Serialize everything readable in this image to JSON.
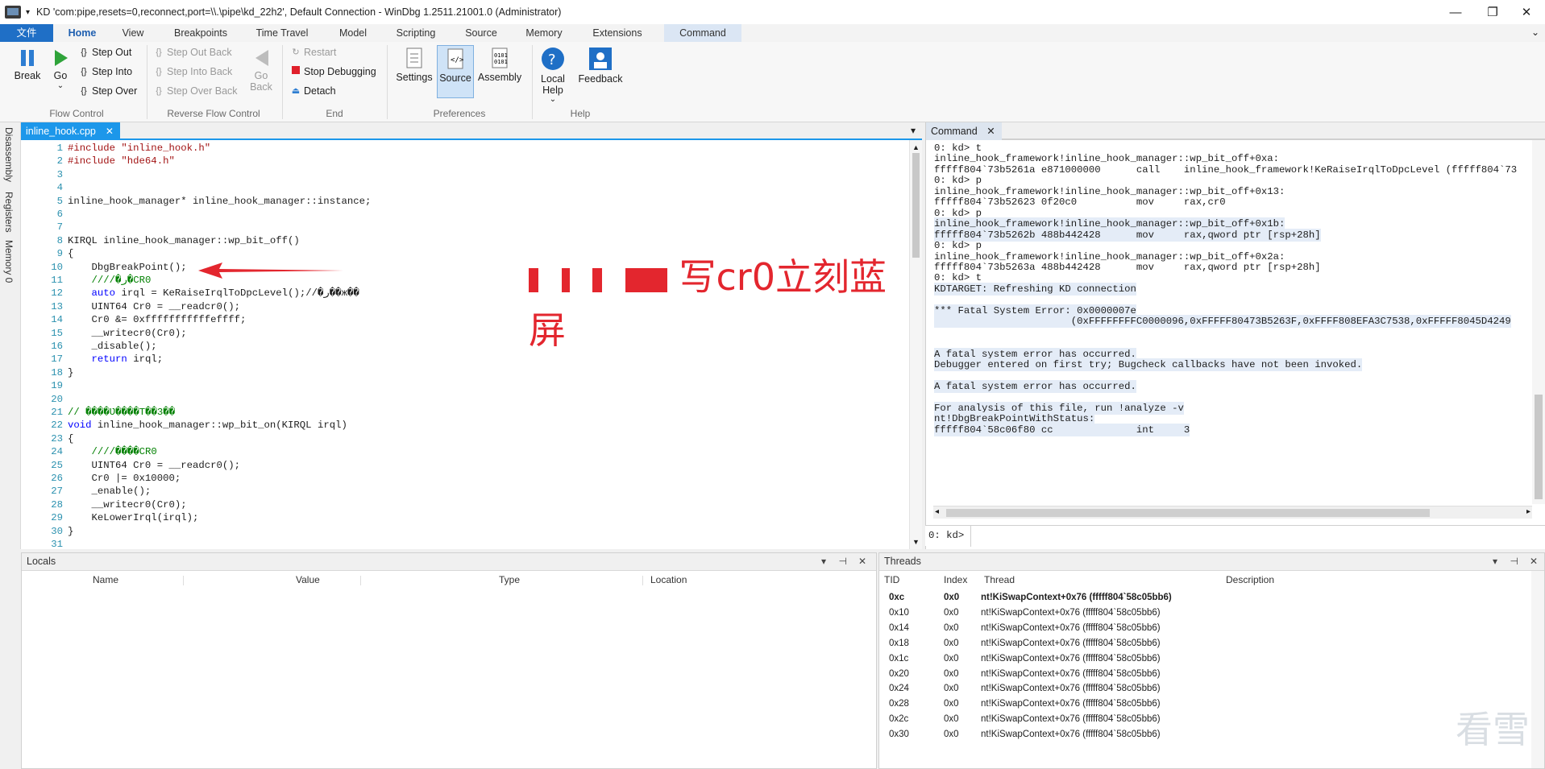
{
  "window": {
    "title": "KD 'com:pipe,resets=0,reconnect,port=\\\\.\\pipe\\kd_22h2', Default Connection  - WinDbg 1.2511.21001.0 (Administrator)",
    "min": "—",
    "max": "❐",
    "close": "✕"
  },
  "tabs": [
    "文件",
    "Home",
    "View",
    "Breakpoints",
    "Time Travel",
    "Model",
    "Scripting",
    "Source",
    "Memory",
    "Extensions",
    "Command"
  ],
  "ribbon": {
    "break": "Break",
    "go": "Go",
    "step_out": "Step Out",
    "step_into": "Step Into",
    "step_over": "Step Over",
    "step_out_back": "Step Out Back",
    "step_into_back": "Step Into Back",
    "step_over_back": "Step Over Back",
    "go_back": "Go Back",
    "restart": "Restart",
    "stop_debugging": "Stop Debugging",
    "detach": "Detach",
    "settings": "Settings",
    "source": "Source",
    "assembly": "Assembly",
    "local_help": "Local Help",
    "feedback": "Feedback",
    "groups": {
      "flow_control": "Flow Control",
      "reverse_flow_control": "Reverse Flow Control",
      "end": "End",
      "preferences": "Preferences",
      "help": "Help"
    }
  },
  "side_tabs": [
    "Disassembly",
    "Registers",
    "Memory 0"
  ],
  "editor": {
    "tab": "inline_hook.cpp",
    "close": "✕",
    "overlay": "写cr0立刻蓝屏",
    "lines": [
      {
        "n": "1",
        "t": "#include \"inline_hook.h\""
      },
      {
        "n": "2",
        "t": "#include \"hde64.h\""
      },
      {
        "n": "3",
        "t": ""
      },
      {
        "n": "4",
        "t": ""
      },
      {
        "n": "5",
        "t": "inline_hook_manager* inline_hook_manager::instance;"
      },
      {
        "n": "6",
        "t": ""
      },
      {
        "n": "7",
        "t": ""
      },
      {
        "n": "8",
        "t": "KIRQL inline_hook_manager::wp_bit_off()"
      },
      {
        "n": "9",
        "t": "{"
      },
      {
        "n": "10",
        "t": "    DbgBreakPoint();"
      },
      {
        "n": "11",
        "t": "    ////�ر�CR0"
      },
      {
        "n": "12",
        "t": "    auto irql = KeRaiseIrqlToDpcLevel();//�ر��ж��"
      },
      {
        "n": "13",
        "t": "    UINT64 Cr0 = __readcr0();"
      },
      {
        "n": "14",
        "t": "    Cr0 &= 0xfffffffffffeffff;"
      },
      {
        "n": "15",
        "t": "    __writecr0(Cr0);"
      },
      {
        "n": "16",
        "t": "    _disable();"
      },
      {
        "n": "17",
        "t": "    return irql;"
      },
      {
        "n": "18",
        "t": "}"
      },
      {
        "n": "19",
        "t": ""
      },
      {
        "n": "20",
        "t": ""
      },
      {
        "n": "21",
        "t": "// ����Ʋ����T��3��"
      },
      {
        "n": "22",
        "t": "void inline_hook_manager::wp_bit_on(KIRQL irql)"
      },
      {
        "n": "23",
        "t": "{"
      },
      {
        "n": "24",
        "t": "    ////����CR0"
      },
      {
        "n": "25",
        "t": "    UINT64 Cr0 = __readcr0();"
      },
      {
        "n": "26",
        "t": "    Cr0 |= 0x10000;"
      },
      {
        "n": "27",
        "t": "    _enable();"
      },
      {
        "n": "28",
        "t": "    __writecr0(Cr0);"
      },
      {
        "n": "29",
        "t": "    KeLowerIrql(irql);"
      },
      {
        "n": "30",
        "t": "}"
      },
      {
        "n": "31",
        "t": ""
      }
    ]
  },
  "command": {
    "tab": "Command",
    "close": "✕",
    "prompt": "0: kd>",
    "lines": [
      {
        "t": "0: kd> t",
        "hl": false
      },
      {
        "t": "inline_hook_framework!inline_hook_manager::wp_bit_off+0xa:",
        "hl": false
      },
      {
        "t": "fffff804`73b5261a e871000000      call    inline_hook_framework!KeRaiseIrqlToDpcLevel (fffff804`73",
        "hl": false
      },
      {
        "t": "0: kd> p",
        "hl": false
      },
      {
        "t": "inline_hook_framework!inline_hook_manager::wp_bit_off+0x13:",
        "hl": false
      },
      {
        "t": "fffff804`73b52623 0f20c0          mov     rax,cr0",
        "hl": false
      },
      {
        "t": "0: kd> p",
        "hl": false
      },
      {
        "t": "inline_hook_framework!inline_hook_manager::wp_bit_off+0x1b:",
        "hl": true
      },
      {
        "t": "fffff804`73b5262b 488b442428      mov     rax,qword ptr [rsp+28h]",
        "hl": true
      },
      {
        "t": "0: kd> p",
        "hl": false
      },
      {
        "t": "inline_hook_framework!inline_hook_manager::wp_bit_off+0x2a:",
        "hl": false
      },
      {
        "t": "fffff804`73b5263a 488b442428      mov     rax,qword ptr [rsp+28h]",
        "hl": false
      },
      {
        "t": "0: kd> t",
        "hl": false
      },
      {
        "t": "KDTARGET: Refreshing KD connection",
        "hl": true
      },
      {
        "t": "",
        "hl": false
      },
      {
        "t": "*** Fatal System Error: 0x0000007e",
        "hl": true
      },
      {
        "t": "                       (0xFFFFFFFFC0000096,0xFFFFF80473B5263F,0xFFFF808EFA3C7538,0xFFFFF8045D4249",
        "hl": true
      },
      {
        "t": "",
        "hl": false
      },
      {
        "t": "",
        "hl": false
      },
      {
        "t": "A fatal system error has occurred.",
        "hl": true
      },
      {
        "t": "Debugger entered on first try; Bugcheck callbacks have not been invoked.",
        "hl": true
      },
      {
        "t": "",
        "hl": false
      },
      {
        "t": "A fatal system error has occurred.",
        "hl": true
      },
      {
        "t": "",
        "hl": false
      },
      {
        "t": "For analysis of this file, run !analyze -v",
        "hl": true
      },
      {
        "t": "nt!DbgBreakPointWithStatus:",
        "hl": true
      },
      {
        "t": "fffff804`58c06f80 cc              int     3",
        "hl": true
      }
    ]
  },
  "locals": {
    "title": "Locals",
    "columns": [
      "Name",
      "Value",
      "Type",
      "Location"
    ]
  },
  "threads": {
    "title": "Threads",
    "columns": [
      "TID",
      "Index",
      "Thread",
      "Description"
    ],
    "rows": [
      {
        "tid": "0xc",
        "index": "0x0",
        "thread": "nt!KiSwapContext+0x76 (fffff804`58c05bb6)",
        "bold": true
      },
      {
        "tid": "0x10",
        "index": "0x0",
        "thread": "nt!KiSwapContext+0x76 (fffff804`58c05bb6)",
        "bold": false
      },
      {
        "tid": "0x14",
        "index": "0x0",
        "thread": "nt!KiSwapContext+0x76 (fffff804`58c05bb6)",
        "bold": false
      },
      {
        "tid": "0x18",
        "index": "0x0",
        "thread": "nt!KiSwapContext+0x76 (fffff804`58c05bb6)",
        "bold": false
      },
      {
        "tid": "0x1c",
        "index": "0x0",
        "thread": "nt!KiSwapContext+0x76 (fffff804`58c05bb6)",
        "bold": false
      },
      {
        "tid": "0x20",
        "index": "0x0",
        "thread": "nt!KiSwapContext+0x76 (fffff804`58c05bb6)",
        "bold": false
      },
      {
        "tid": "0x24",
        "index": "0x0",
        "thread": "nt!KiSwapContext+0x76 (fffff804`58c05bb6)",
        "bold": false
      },
      {
        "tid": "0x28",
        "index": "0x0",
        "thread": "nt!KiSwapContext+0x76 (fffff804`58c05bb6)",
        "bold": false
      },
      {
        "tid": "0x2c",
        "index": "0x0",
        "thread": "nt!KiSwapContext+0x76 (fffff804`58c05bb6)",
        "bold": false
      },
      {
        "tid": "0x30",
        "index": "0x0",
        "thread": "nt!KiSwapContext+0x76 (fffff804`58c05bb6)",
        "bold": false
      }
    ]
  },
  "watermark": "看雪"
}
